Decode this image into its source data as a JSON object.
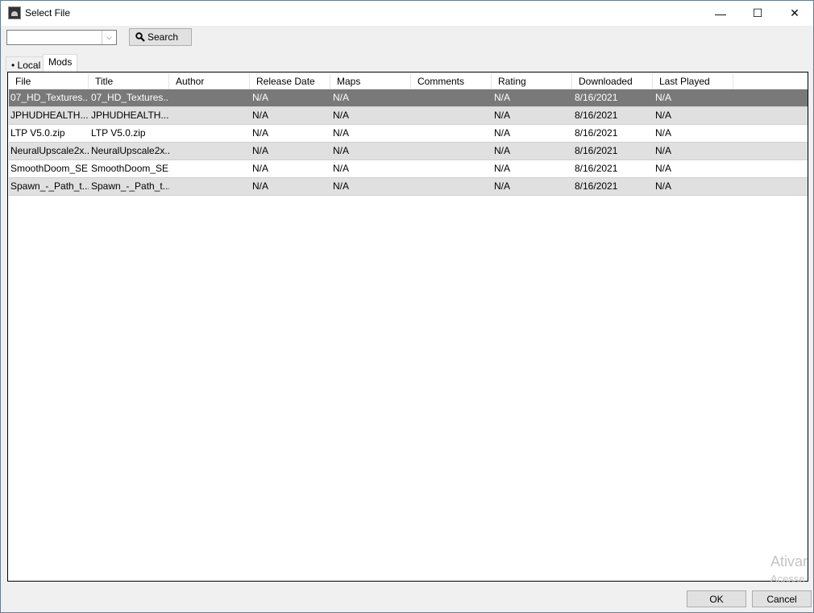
{
  "window": {
    "title": "Select File",
    "minimize": "—",
    "maximize": "☐",
    "close": "✕"
  },
  "toolbar": {
    "combo_value": "",
    "search_label": "Search"
  },
  "tabs": [
    {
      "label": "Local",
      "dot": "•"
    },
    {
      "label": "Mods"
    }
  ],
  "columns": [
    "File",
    "Title",
    "Author",
    "Release Date",
    "Maps",
    "Comments",
    "Rating",
    "Downloaded",
    "Last Played"
  ],
  "rows": [
    [
      "07_HD_Textures....",
      "07_HD_Textures....",
      "",
      "N/A",
      "N/A",
      "",
      "N/A",
      "8/16/2021",
      "N/A"
    ],
    [
      "JPHUDHEALTH...",
      "JPHUDHEALTH...",
      "",
      "N/A",
      "N/A",
      "",
      "N/A",
      "8/16/2021",
      "N/A"
    ],
    [
      "LTP V5.0.zip",
      "LTP V5.0.zip",
      "",
      "N/A",
      "N/A",
      "",
      "N/A",
      "8/16/2021",
      "N/A"
    ],
    [
      "NeuralUpscale2x...",
      "NeuralUpscale2x...",
      "",
      "N/A",
      "N/A",
      "",
      "N/A",
      "8/16/2021",
      "N/A"
    ],
    [
      "SmoothDoom_SE...",
      "SmoothDoom_SE...",
      "",
      "N/A",
      "N/A",
      "",
      "N/A",
      "8/16/2021",
      "N/A"
    ],
    [
      "Spawn_-_Path_t...",
      "Spawn_-_Path_t...",
      "",
      "N/A",
      "N/A",
      "",
      "N/A",
      "8/16/2021",
      "N/A"
    ]
  ],
  "selected_row": 0,
  "footer": {
    "ok": "OK",
    "cancel": "Cancel"
  },
  "watermark": {
    "line1": "Ativar",
    "line2": "Acesse"
  }
}
